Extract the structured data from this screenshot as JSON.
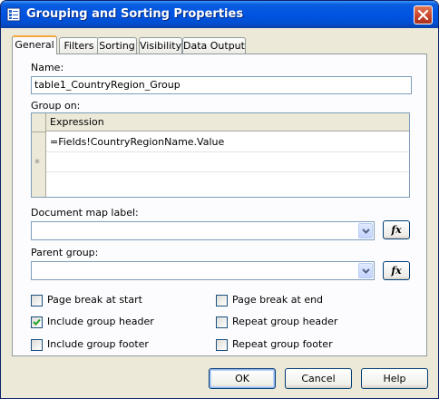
{
  "window": {
    "title": "Grouping and Sorting Properties",
    "icon": "properties-icon"
  },
  "tabs": [
    {
      "label": "General",
      "active": true
    },
    {
      "label": "Filters",
      "active": false
    },
    {
      "label": "Sorting",
      "active": false
    },
    {
      "label": "Visibility",
      "active": false
    },
    {
      "label": "Data Output",
      "active": false
    }
  ],
  "general": {
    "name_label": "Name:",
    "name_value": "table1_CountryRegion_Group",
    "group_on_label": "Group on:",
    "grid": {
      "column_header": "Expression",
      "rows": [
        "=Fields!CountryRegionName.Value",
        "",
        ""
      ],
      "new_row_marker": "*"
    },
    "document_map_label": "Document map label:",
    "document_map_value": "",
    "parent_group_label": "Parent group:",
    "parent_group_value": "",
    "fx_label": "fx",
    "checkboxes": {
      "page_break_start": {
        "label": "Page break at start",
        "checked": false
      },
      "include_group_header": {
        "label": "Include group header",
        "checked": true
      },
      "include_group_footer": {
        "label": "Include group footer",
        "checked": false
      },
      "page_break_end": {
        "label": "Page break at end",
        "checked": false
      },
      "repeat_group_header": {
        "label": "Repeat group header",
        "checked": false
      },
      "repeat_group_footer": {
        "label": "Repeat group footer",
        "checked": false
      }
    }
  },
  "buttons": {
    "ok": "OK",
    "cancel": "Cancel",
    "help": "Help"
  },
  "colors": {
    "titlebar": "#0054e3",
    "dialog_bg": "#ece9d8",
    "active_tab_accent": "#f3a73e",
    "checkmark": "#21a121"
  }
}
